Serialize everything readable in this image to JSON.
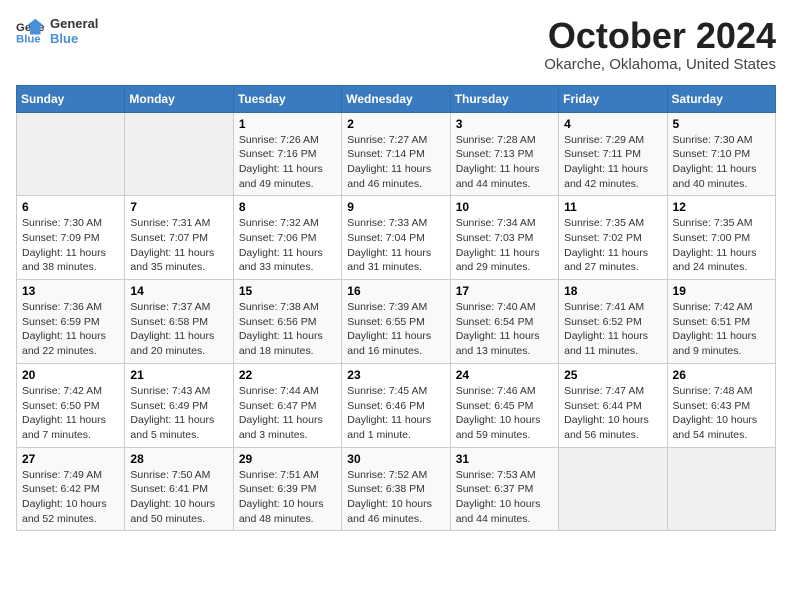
{
  "logo": {
    "line1": "General",
    "line2": "Blue"
  },
  "title": "October 2024",
  "location": "Okarche, Oklahoma, United States",
  "days_of_week": [
    "Sunday",
    "Monday",
    "Tuesday",
    "Wednesday",
    "Thursday",
    "Friday",
    "Saturday"
  ],
  "weeks": [
    [
      {
        "day": "",
        "sunrise": "",
        "sunset": "",
        "daylight": ""
      },
      {
        "day": "",
        "sunrise": "",
        "sunset": "",
        "daylight": ""
      },
      {
        "day": "1",
        "sunrise": "Sunrise: 7:26 AM",
        "sunset": "Sunset: 7:16 PM",
        "daylight": "Daylight: 11 hours and 49 minutes."
      },
      {
        "day": "2",
        "sunrise": "Sunrise: 7:27 AM",
        "sunset": "Sunset: 7:14 PM",
        "daylight": "Daylight: 11 hours and 46 minutes."
      },
      {
        "day": "3",
        "sunrise": "Sunrise: 7:28 AM",
        "sunset": "Sunset: 7:13 PM",
        "daylight": "Daylight: 11 hours and 44 minutes."
      },
      {
        "day": "4",
        "sunrise": "Sunrise: 7:29 AM",
        "sunset": "Sunset: 7:11 PM",
        "daylight": "Daylight: 11 hours and 42 minutes."
      },
      {
        "day": "5",
        "sunrise": "Sunrise: 7:30 AM",
        "sunset": "Sunset: 7:10 PM",
        "daylight": "Daylight: 11 hours and 40 minutes."
      }
    ],
    [
      {
        "day": "6",
        "sunrise": "Sunrise: 7:30 AM",
        "sunset": "Sunset: 7:09 PM",
        "daylight": "Daylight: 11 hours and 38 minutes."
      },
      {
        "day": "7",
        "sunrise": "Sunrise: 7:31 AM",
        "sunset": "Sunset: 7:07 PM",
        "daylight": "Daylight: 11 hours and 35 minutes."
      },
      {
        "day": "8",
        "sunrise": "Sunrise: 7:32 AM",
        "sunset": "Sunset: 7:06 PM",
        "daylight": "Daylight: 11 hours and 33 minutes."
      },
      {
        "day": "9",
        "sunrise": "Sunrise: 7:33 AM",
        "sunset": "Sunset: 7:04 PM",
        "daylight": "Daylight: 11 hours and 31 minutes."
      },
      {
        "day": "10",
        "sunrise": "Sunrise: 7:34 AM",
        "sunset": "Sunset: 7:03 PM",
        "daylight": "Daylight: 11 hours and 29 minutes."
      },
      {
        "day": "11",
        "sunrise": "Sunrise: 7:35 AM",
        "sunset": "Sunset: 7:02 PM",
        "daylight": "Daylight: 11 hours and 27 minutes."
      },
      {
        "day": "12",
        "sunrise": "Sunrise: 7:35 AM",
        "sunset": "Sunset: 7:00 PM",
        "daylight": "Daylight: 11 hours and 24 minutes."
      }
    ],
    [
      {
        "day": "13",
        "sunrise": "Sunrise: 7:36 AM",
        "sunset": "Sunset: 6:59 PM",
        "daylight": "Daylight: 11 hours and 22 minutes."
      },
      {
        "day": "14",
        "sunrise": "Sunrise: 7:37 AM",
        "sunset": "Sunset: 6:58 PM",
        "daylight": "Daylight: 11 hours and 20 minutes."
      },
      {
        "day": "15",
        "sunrise": "Sunrise: 7:38 AM",
        "sunset": "Sunset: 6:56 PM",
        "daylight": "Daylight: 11 hours and 18 minutes."
      },
      {
        "day": "16",
        "sunrise": "Sunrise: 7:39 AM",
        "sunset": "Sunset: 6:55 PM",
        "daylight": "Daylight: 11 hours and 16 minutes."
      },
      {
        "day": "17",
        "sunrise": "Sunrise: 7:40 AM",
        "sunset": "Sunset: 6:54 PM",
        "daylight": "Daylight: 11 hours and 13 minutes."
      },
      {
        "day": "18",
        "sunrise": "Sunrise: 7:41 AM",
        "sunset": "Sunset: 6:52 PM",
        "daylight": "Daylight: 11 hours and 11 minutes."
      },
      {
        "day": "19",
        "sunrise": "Sunrise: 7:42 AM",
        "sunset": "Sunset: 6:51 PM",
        "daylight": "Daylight: 11 hours and 9 minutes."
      }
    ],
    [
      {
        "day": "20",
        "sunrise": "Sunrise: 7:42 AM",
        "sunset": "Sunset: 6:50 PM",
        "daylight": "Daylight: 11 hours and 7 minutes."
      },
      {
        "day": "21",
        "sunrise": "Sunrise: 7:43 AM",
        "sunset": "Sunset: 6:49 PM",
        "daylight": "Daylight: 11 hours and 5 minutes."
      },
      {
        "day": "22",
        "sunrise": "Sunrise: 7:44 AM",
        "sunset": "Sunset: 6:47 PM",
        "daylight": "Daylight: 11 hours and 3 minutes."
      },
      {
        "day": "23",
        "sunrise": "Sunrise: 7:45 AM",
        "sunset": "Sunset: 6:46 PM",
        "daylight": "Daylight: 11 hours and 1 minute."
      },
      {
        "day": "24",
        "sunrise": "Sunrise: 7:46 AM",
        "sunset": "Sunset: 6:45 PM",
        "daylight": "Daylight: 10 hours and 59 minutes."
      },
      {
        "day": "25",
        "sunrise": "Sunrise: 7:47 AM",
        "sunset": "Sunset: 6:44 PM",
        "daylight": "Daylight: 10 hours and 56 minutes."
      },
      {
        "day": "26",
        "sunrise": "Sunrise: 7:48 AM",
        "sunset": "Sunset: 6:43 PM",
        "daylight": "Daylight: 10 hours and 54 minutes."
      }
    ],
    [
      {
        "day": "27",
        "sunrise": "Sunrise: 7:49 AM",
        "sunset": "Sunset: 6:42 PM",
        "daylight": "Daylight: 10 hours and 52 minutes."
      },
      {
        "day": "28",
        "sunrise": "Sunrise: 7:50 AM",
        "sunset": "Sunset: 6:41 PM",
        "daylight": "Daylight: 10 hours and 50 minutes."
      },
      {
        "day": "29",
        "sunrise": "Sunrise: 7:51 AM",
        "sunset": "Sunset: 6:39 PM",
        "daylight": "Daylight: 10 hours and 48 minutes."
      },
      {
        "day": "30",
        "sunrise": "Sunrise: 7:52 AM",
        "sunset": "Sunset: 6:38 PM",
        "daylight": "Daylight: 10 hours and 46 minutes."
      },
      {
        "day": "31",
        "sunrise": "Sunrise: 7:53 AM",
        "sunset": "Sunset: 6:37 PM",
        "daylight": "Daylight: 10 hours and 44 minutes."
      },
      {
        "day": "",
        "sunrise": "",
        "sunset": "",
        "daylight": ""
      },
      {
        "day": "",
        "sunrise": "",
        "sunset": "",
        "daylight": ""
      }
    ]
  ]
}
